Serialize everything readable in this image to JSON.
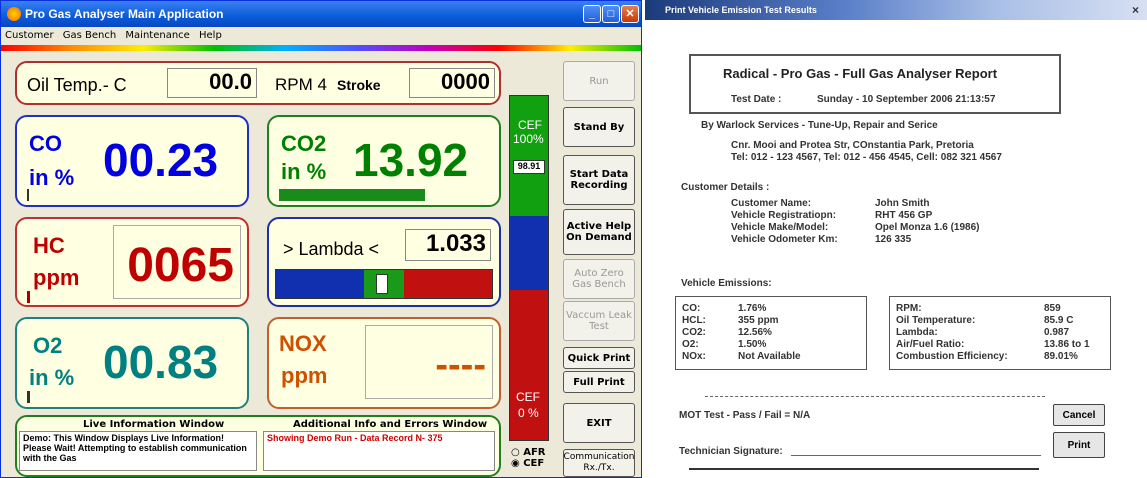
{
  "app": {
    "title": "Pro Gas Analyser Main Application",
    "menu": [
      "Customer",
      "Gas Bench",
      "Maintenance",
      "Help"
    ]
  },
  "oil": {
    "label": "Oil Temp.- C",
    "value": "00.0",
    "rpm_label": "RPM 4",
    "stroke_label": "Stroke",
    "rpm_value": "0000"
  },
  "co": {
    "label1": "CO",
    "label2": "in %",
    "value": "00.23",
    "color": "#0000e0"
  },
  "co2": {
    "label1": "CO2",
    "label2": "in %",
    "value": "13.92",
    "color": "#008000"
  },
  "hc": {
    "label1": "HC",
    "label2": "ppm",
    "value": "0065",
    "color": "#c00000"
  },
  "lambda": {
    "label": "> Lambda <",
    "value": "1.033"
  },
  "o2": {
    "label1": "O2",
    "label2": "in %",
    "value": "00.83",
    "color": "#008080"
  },
  "nox": {
    "label1": "NOX",
    "label2": "ppm",
    "value": "----"
  },
  "cef": {
    "top": "CEF",
    "top_pct": "100%",
    "reading": "98.91",
    "bottom": "CEF",
    "bottom_pct": "0 %",
    "afr": "AFR",
    "cef_opt": "CEF"
  },
  "buttons": {
    "run": "Run",
    "standby": "Stand By",
    "start_data": "Start Data Recording",
    "active_help": "Active Help On Demand",
    "auto_zero": "Auto Zero Gas Bench",
    "vaccum": "Vaccum Leak Test",
    "quick_print": "Quick Print",
    "full_print": "Full Print",
    "exit": "EXIT",
    "comm": "Communication Rx./Tx."
  },
  "live": {
    "title": "Live Information Window",
    "text": "Demo: This Window Displays Live Information! Please Wait! Attempting to establish communication with the Gas"
  },
  "errors": {
    "title": "Additional Info and Errors Window",
    "text": "Showing Demo Run - Data Record N- 375"
  },
  "report": {
    "window_title": "Print Vehicle Emission Test Results",
    "heading": "Radical - Pro Gas   - Full Gas Analyser Report",
    "test_date_label": "Test Date :",
    "test_date": "Sunday - 10 September 2006  21:13:57",
    "by": "By Warlock Services - Tune-Up, Repair and Serice",
    "addr1": "Cnr. Mooi and Protea Str, COnstantia Park, Pretoria",
    "addr2": "Tel:  012 - 123 4567,  Tel:  012 - 456 4545,  Cell:  082 321 4567",
    "customer_title": "Customer Details :",
    "customer_labels": [
      "Customer Name:",
      "Vehicle Registratiopn:",
      "Vehicle Make/Model:",
      "Vehicle Odometer Km:"
    ],
    "customer_values": [
      "John Smith",
      "RHT 456 GP",
      "Opel Monza 1.6 (1986)",
      "126 335"
    ],
    "emissions_title": "Vehicle Emissions:",
    "em_left_labels": [
      "CO:",
      "HCL:",
      "CO2:",
      "O2:",
      "NOx:"
    ],
    "em_left_values": [
      "1.76%",
      "355 ppm",
      "12.56%",
      "1.50%",
      "Not Available"
    ],
    "em_right_labels": [
      "RPM:",
      "Oil Temperature:",
      "Lambda:",
      "Air/Fuel Ratio:",
      "Combustion Efficiency:"
    ],
    "em_right_values": [
      "859",
      "85.9 C",
      "0.987",
      "13.86 to 1",
      "89.01%"
    ],
    "mot": "MOT Test - Pass / Fail = N/A",
    "signature": "Technician Signature:",
    "cancel": "Cancel",
    "print": "Print"
  }
}
